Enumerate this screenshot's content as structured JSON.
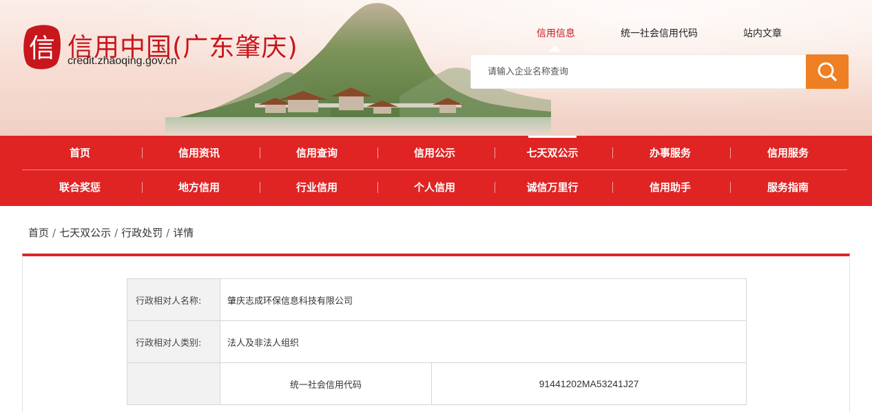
{
  "header": {
    "site_title": "信用中国(广东肇庆)",
    "domain": "credit.zhaoqing.gov.cn",
    "logo_char": "信",
    "brand_color": "#c8161d",
    "top_links": [
      {
        "label": "信用信息",
        "active": true
      },
      {
        "label": "统一社会信用代码",
        "active": false
      },
      {
        "label": "站内文章",
        "active": false
      }
    ],
    "search": {
      "placeholder": "请输入企业名称查询",
      "value": "",
      "button_icon": "search-icon",
      "button_color": "#ee7f22"
    }
  },
  "nav": {
    "color": "#e02424",
    "rows": [
      [
        "首页",
        "信用资讯",
        "信用查询",
        "信用公示",
        "七天双公示",
        "办事服务",
        "信用服务"
      ],
      [
        "联合奖惩",
        "地方信用",
        "行业信用",
        "个人信用",
        "诚信万里行",
        "信用助手",
        "服务指南"
      ]
    ],
    "current": "七天双公示"
  },
  "breadcrumb": [
    "首页",
    "七天双公示",
    "行政处罚",
    "详情"
  ],
  "detail": {
    "name_label": "行政相对人名称:",
    "name_value": "肇庆志成环保信息科技有限公司",
    "type_label": "行政相对人类别:",
    "type_value": "法人及非法人组织",
    "credit_code_label": "统一社会信用代码",
    "credit_code_value": "91441202MA53241J27"
  }
}
